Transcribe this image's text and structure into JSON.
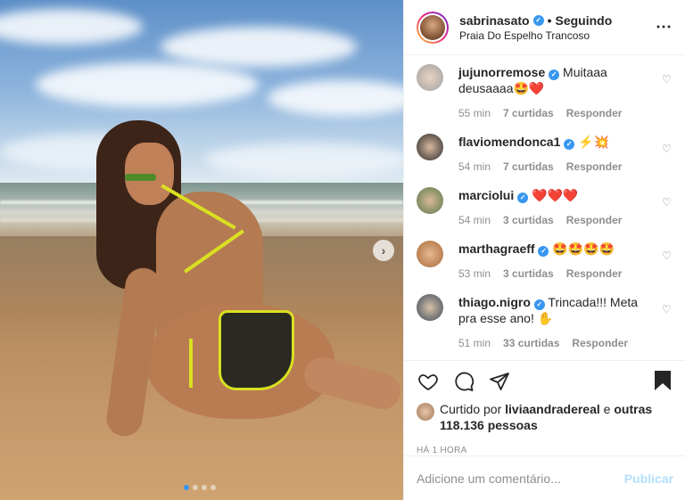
{
  "header": {
    "username": "sabrinasato",
    "separator": "•",
    "follow_status": "Seguindo",
    "location": "Praia Do Espelho Trancoso",
    "more_icon": "⋯"
  },
  "comments": [
    {
      "user": "jujunorremose",
      "verified": true,
      "text": "Muitaaa deusaaaa🤩❤️",
      "time": "55 min",
      "likes": "7 curtidas",
      "reply": "Responder",
      "avatar_color": "#cfcfcf"
    },
    {
      "user": "flaviomendonca1",
      "verified": true,
      "text": "⚡💥",
      "time": "54 min",
      "likes": "7 curtidas",
      "reply": "Responder",
      "avatar_color": "#3a3a3a"
    },
    {
      "user": "marciolui",
      "verified": true,
      "text": "❤️❤️❤️",
      "time": "54 min",
      "likes": "3 curtidas",
      "reply": "Responder",
      "avatar_color": "#8a9a70"
    },
    {
      "user": "marthagraeff",
      "verified": true,
      "text": "🤩🤩🤩🤩",
      "time": "53 min",
      "likes": "3 curtidas",
      "reply": "Responder",
      "avatar_color": "#c98a5a"
    },
    {
      "user": "thiago.nigro",
      "verified": true,
      "text": "Trincada!!! Meta pra esse ano! ✋",
      "time": "51 min",
      "likes": "33 curtidas",
      "reply": "Responder",
      "avatar_color": "#5a6a7a"
    }
  ],
  "likes": {
    "prefix": "Curtido por",
    "user": "liviaandradereal",
    "connector": "e",
    "others": "outras 118.136 pessoas"
  },
  "timestamp": "Há 1 hora",
  "add_comment": {
    "placeholder": "Adicione um comentário...",
    "publish": "Publicar"
  },
  "carousel": {
    "next": "›",
    "total_dots": 4,
    "active_dot": 1
  },
  "icons": {
    "like": "heart-icon",
    "comment": "comment-icon",
    "share": "share-icon",
    "save": "bookmark-icon"
  },
  "colors": {
    "verified": "#3897f0",
    "publish_disabled": "#b2dffc",
    "meta_gray": "#8e8e8e"
  }
}
